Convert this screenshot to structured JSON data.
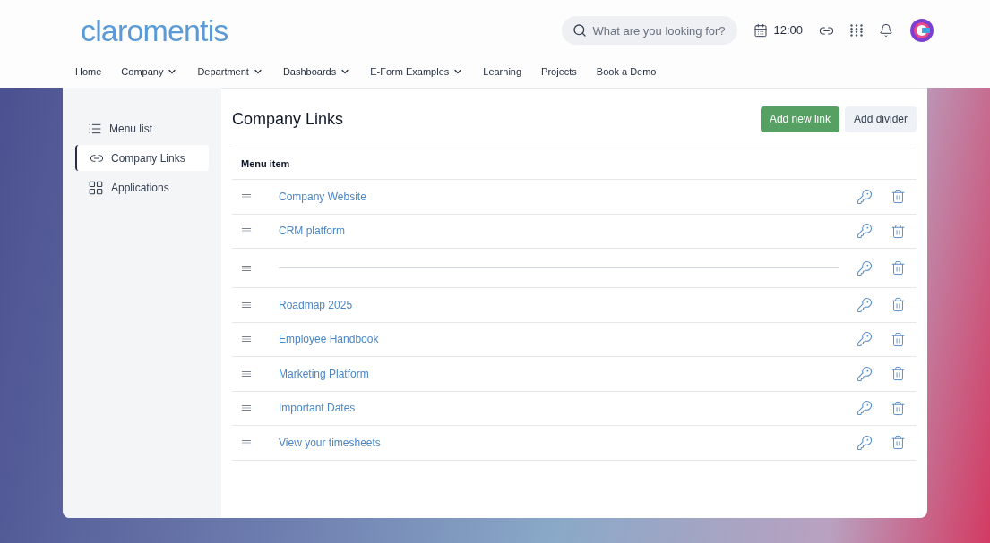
{
  "header": {
    "logo": "claromentis",
    "search": {
      "placeholder": "What are you looking for?"
    },
    "time": "12:00"
  },
  "nav": [
    {
      "label": "Home",
      "dropdown": false
    },
    {
      "label": "Company",
      "dropdown": true
    },
    {
      "label": "Department",
      "dropdown": true
    },
    {
      "label": "Dashboards",
      "dropdown": true
    },
    {
      "label": "E-Form Examples",
      "dropdown": true
    },
    {
      "label": "Learning",
      "dropdown": false
    },
    {
      "label": "Projects",
      "dropdown": false
    },
    {
      "label": "Book a Demo",
      "dropdown": false
    }
  ],
  "sidebar": {
    "items": [
      {
        "label": "Menu list",
        "selected": false
      },
      {
        "label": "Company Links",
        "selected": true
      },
      {
        "label": "Applications",
        "selected": false
      }
    ]
  },
  "main": {
    "title": "Company Links",
    "buttons": [
      {
        "label": "Add new link",
        "kind": "primary"
      },
      {
        "label": "Add divider",
        "kind": "secondary"
      }
    ],
    "table": {
      "columns": [
        "Menu item"
      ],
      "rows": [
        {
          "kind": "link",
          "label": "Company Website"
        },
        {
          "kind": "link",
          "label": "CRM platform"
        },
        {
          "kind": "divider"
        },
        {
          "kind": "link",
          "label": "Roadmap 2025"
        },
        {
          "kind": "link",
          "label": "Employee Handbook"
        },
        {
          "kind": "link",
          "label": "Marketing Platform"
        },
        {
          "kind": "link",
          "label": "Important Dates"
        },
        {
          "kind": "link",
          "label": "View your timesheets"
        }
      ]
    }
  }
}
